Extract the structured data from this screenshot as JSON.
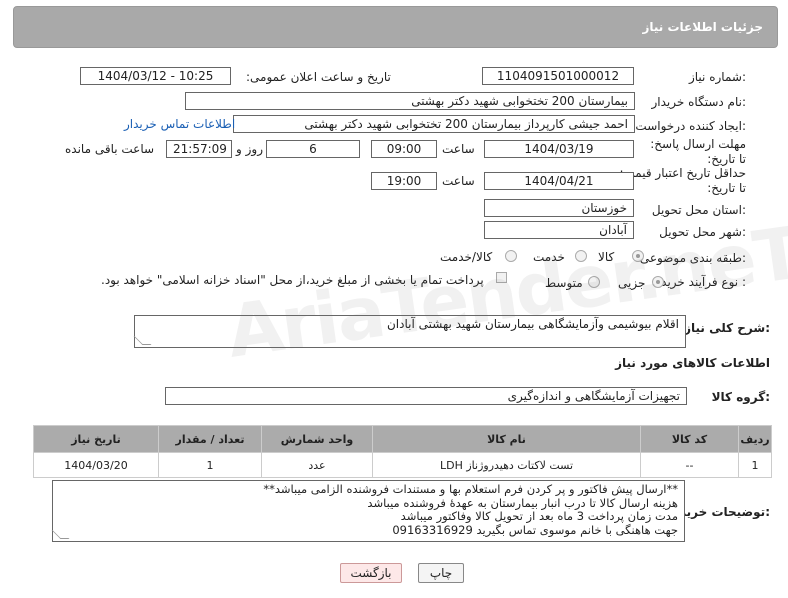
{
  "header": {
    "title": "جزئیات اطلاعات نیاز"
  },
  "fields": {
    "need_number_label": "شماره نیاز:",
    "need_number": "1104091501000012",
    "announce_label": "تاریخ و ساعت اعلان عمومی:",
    "announce_value": "1404/03/12 - 10:25",
    "buyer_org_label": "نام دستگاه خریدار:",
    "buyer_org": "بیمارستان 200 تختخوابی شهید دکتر بهشتی",
    "requester_label": "ایجاد کننده درخواست:",
    "requester": "احمد جیشی کارپرداز بیمارستان 200 تختخوابی شهید دکتر بهشتی",
    "buyer_contact_link": "اطلاعات تماس خریدار",
    "reply_deadline_label": "مهلت ارسال پاسخ: تا تاریخ:",
    "reply_date": "1404/03/19",
    "time_label": "ساعت",
    "reply_time": "09:00",
    "days_value": "6",
    "days_and_label": "روز و",
    "remaining_time": "21:57:09",
    "remaining_label": "ساعت باقی مانده",
    "price_validity_label": "حداقل تاریخ اعتبار قیمت: تا تاریخ:",
    "price_date": "1404/04/21",
    "price_time": "19:00",
    "province_label": "استان محل تحویل:",
    "province": "خوزستان",
    "city_label": "شهر محل تحویل:",
    "city": "آبادان",
    "category_label": "طبقه بندی موضوعی:",
    "category_options": [
      "کالا",
      "خدمت",
      "کالا/خدمت"
    ],
    "purchase_type_label": "نوع فرآیند خرید :",
    "purchase_options": [
      "جزیی",
      "متوسط"
    ],
    "payment_note": "پرداخت تمام یا بخشی از مبلغ خرید،از محل \"اسناد خزانه اسلامی\" خواهد بود.",
    "description_label": "شرح کلی نیاز:",
    "description": "اقلام بیوشیمی وآزمایشگاهی بیمارستان شهید بهشتی آبادان",
    "goods_info_title": "اطلاعات کالاهای مورد نیاز",
    "goods_group_label": "گروه کالا:",
    "goods_group": "تجهیزات آزمایشگاهی و اندازه‌گیری"
  },
  "table": {
    "headers": [
      "ردیف",
      "کد کالا",
      "نام کالا",
      "واحد شمارش",
      "تعداد / مقدار",
      "تاریخ نیاز"
    ],
    "rows": [
      [
        "1",
        "--",
        "تست لاکتات دهیدروژناز LDH",
        "عدد",
        "1",
        "1404/03/20"
      ]
    ]
  },
  "buyer_notes": {
    "label": "توضیحات خریدار:",
    "lines": [
      "**ارسال پیش فاکتور و پر کردن فرم استعلام بها  و مستندات فروشنده الزامی میباشد**",
      "هزینه ارسال کالا تا درب انبار بیمارستان به عهدهٔ فروشنده میباشد",
      "مدت زمان پرداخت 3 ماه بعد از تحویل کالا وفاکتور میباشد",
      "جهت هاهنگی با خانم موسوی تماس بگیرید 09163316929"
    ]
  },
  "buttons": {
    "print": "چاپ",
    "back": "بازگشت"
  },
  "watermark": "AriaTender.neT"
}
